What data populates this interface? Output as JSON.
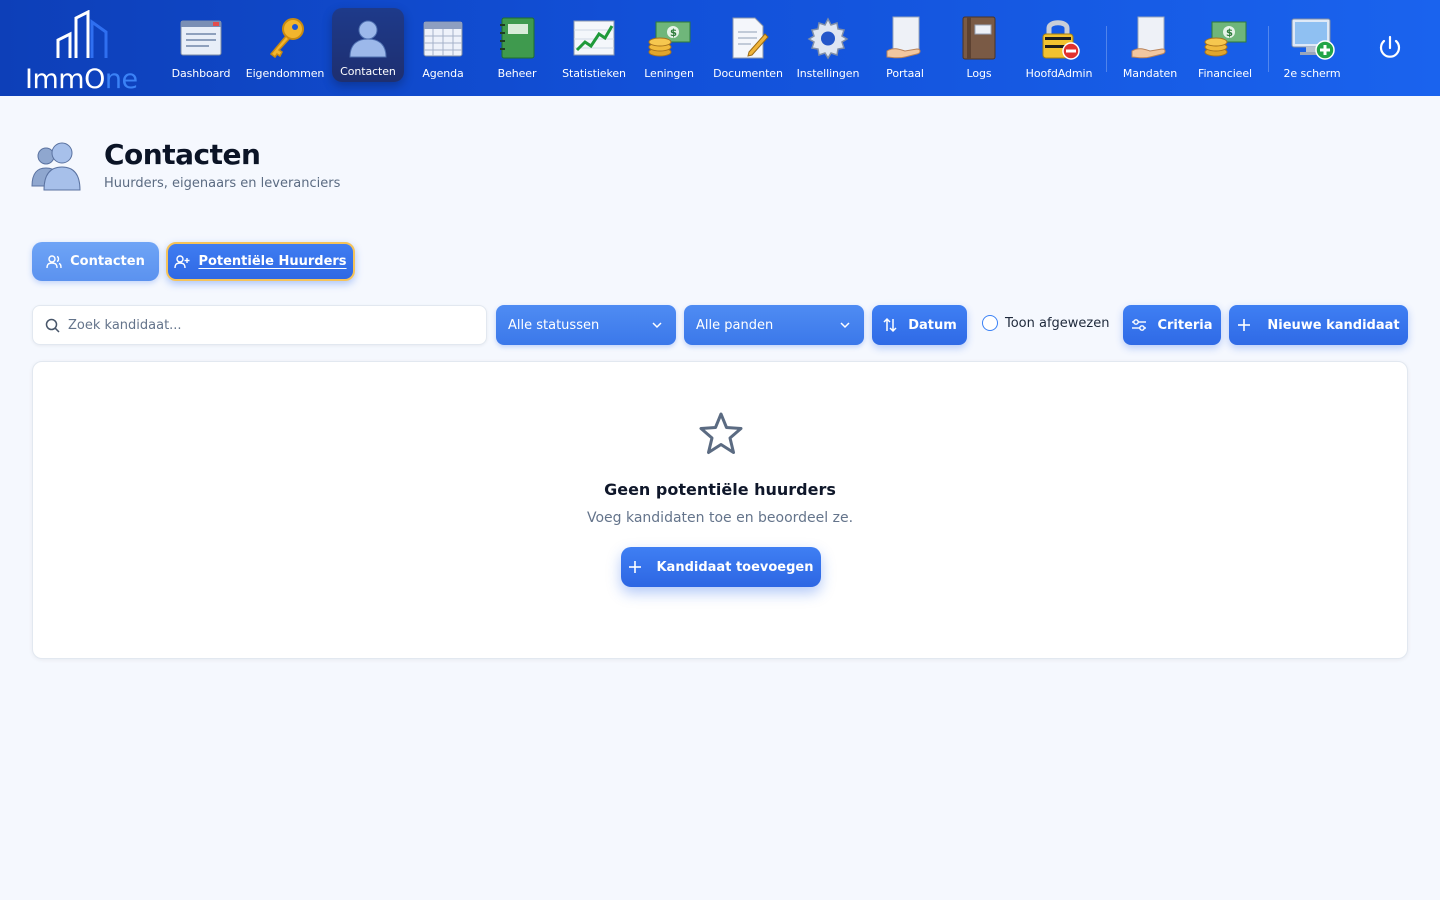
{
  "app": {
    "logo_text_main": "ImmO",
    "logo_text_accent": "ne",
    "accent_color": "#2563eb",
    "highlight_border_color": "#f5c35a"
  },
  "nav": {
    "items": [
      {
        "label": "Dashboard",
        "icon": "dashboard-window-icon"
      },
      {
        "label": "Eigendommen",
        "icon": "key-icon"
      },
      {
        "label": "Contacten",
        "icon": "user-icon",
        "active": true
      },
      {
        "label": "Agenda",
        "icon": "calendar-icon"
      },
      {
        "label": "Beheer",
        "icon": "notebook-icon"
      },
      {
        "label": "Statistieken",
        "icon": "chart-icon"
      },
      {
        "label": "Leningen",
        "icon": "money-coins-icon"
      },
      {
        "label": "Documenten",
        "icon": "document-pencil-icon"
      },
      {
        "label": "Instellingen",
        "icon": "gear-icon"
      },
      {
        "label": "Portaal",
        "icon": "hand-card-icon"
      },
      {
        "label": "Logs",
        "icon": "logbook-icon"
      },
      {
        "label": "HoofdAdmin",
        "icon": "padlock-icon"
      },
      {
        "label": "Mandaten",
        "icon": "hand-card-icon"
      },
      {
        "label": "Financieel",
        "icon": "money-coins-icon"
      },
      {
        "label": "2e scherm",
        "icon": "monitor-add-icon"
      }
    ],
    "power_icon": "power-icon"
  },
  "header": {
    "title": "Contacten",
    "subtitle": "Huurders, eigenaars en leveranciers",
    "icon": "users-icon"
  },
  "tabs": [
    {
      "label": "Contacten",
      "icon": "users-icon",
      "active": false
    },
    {
      "label": "Potentiële Huurders",
      "icon": "user-plus-icon",
      "active": true
    }
  ],
  "filters": {
    "search_placeholder": "Zoek kandidaat...",
    "status_select": "Alle statussen",
    "property_select": "Alle panden",
    "sort_button": "Datum",
    "show_rejected_label": "Toon afgewezen",
    "show_rejected_checked": false,
    "criteria_button": "Criteria",
    "new_candidate_button": "Nieuwe kandidaat"
  },
  "empty_state": {
    "icon": "star-icon",
    "title": "Geen potentiële huurders",
    "subtitle": "Voeg kandidaten toe en beoordeel ze.",
    "button": "Kandidaat toevoegen"
  }
}
